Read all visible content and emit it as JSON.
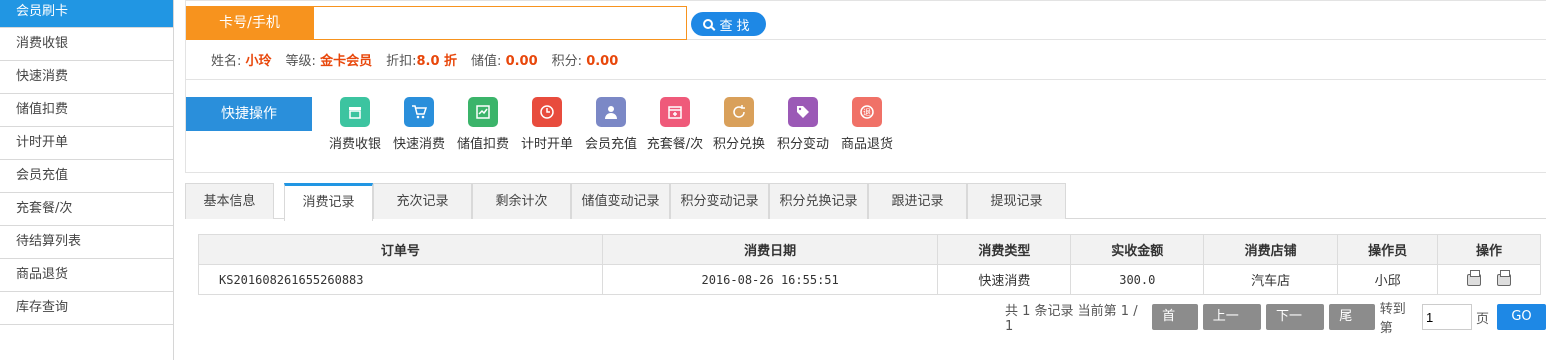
{
  "sidebar": {
    "items": [
      {
        "label": "会员刷卡"
      },
      {
        "label": "消费收银"
      },
      {
        "label": "快速消费"
      },
      {
        "label": "储值扣费"
      },
      {
        "label": "计时开单"
      },
      {
        "label": "会员充值"
      },
      {
        "label": "充套餐/次"
      },
      {
        "label": "待结算列表"
      },
      {
        "label": "商品退货"
      },
      {
        "label": "库存查询"
      }
    ]
  },
  "search": {
    "label": "卡号/手机",
    "value": "",
    "button": "查找"
  },
  "member": {
    "name_label": "姓名:",
    "name": "小玲",
    "level_label": "等级:",
    "level": "金卡会员",
    "discount_label": "折扣:",
    "discount": "8.0 折",
    "balance_label": "储值:",
    "balance": "0.00",
    "points_label": "积分:",
    "points": "0.00"
  },
  "quick": {
    "label": "快捷操作",
    "items": [
      {
        "label": "消费收银",
        "icon": "store-icon",
        "color": "#3cc4a0"
      },
      {
        "label": "快速消费",
        "icon": "cart-icon",
        "color": "#2a8fdb"
      },
      {
        "label": "储值扣费",
        "icon": "chart-icon",
        "color": "#3bb46a"
      },
      {
        "label": "计时开单",
        "icon": "clock-icon",
        "color": "#e84c3d"
      },
      {
        "label": "会员充值",
        "icon": "user-icon",
        "color": "#7b88c6"
      },
      {
        "label": "充套餐/次",
        "icon": "calendar-icon",
        "color": "#ef5a7a"
      },
      {
        "label": "积分兑换",
        "icon": "refresh-icon",
        "color": "#d9a05a"
      },
      {
        "label": "积分变动",
        "icon": "tag-icon",
        "color": "#9b59b6"
      },
      {
        "label": "商品退货",
        "icon": "return-icon",
        "color": "#f07167"
      }
    ]
  },
  "tabs": [
    {
      "label": "基本信息"
    },
    {
      "label": "消费记录"
    },
    {
      "label": "充次记录"
    },
    {
      "label": "剩余计次"
    },
    {
      "label": "储值变动记录"
    },
    {
      "label": "积分变动记录"
    },
    {
      "label": "积分兑换记录"
    },
    {
      "label": "跟进记录"
    },
    {
      "label": "提现记录"
    }
  ],
  "table": {
    "headers": [
      "订单号",
      "消费日期",
      "消费类型",
      "实收金额",
      "消费店铺",
      "操作员",
      "操作"
    ],
    "rows": [
      {
        "order": "KS20160826165526088​3",
        "date": "2016-08-26 16:55:51",
        "type": "快速消费",
        "amount": "300.0",
        "shop": "汽车店",
        "operator": "小邱"
      }
    ]
  },
  "pager": {
    "summary": "共 1 条记录 当前第 1 / 1",
    "first": "首页",
    "prev": "上一页",
    "next": "下一页",
    "last": "尾页",
    "goto_label": "转到第",
    "page_value": "1",
    "page_unit": "页",
    "go": "GO"
  }
}
